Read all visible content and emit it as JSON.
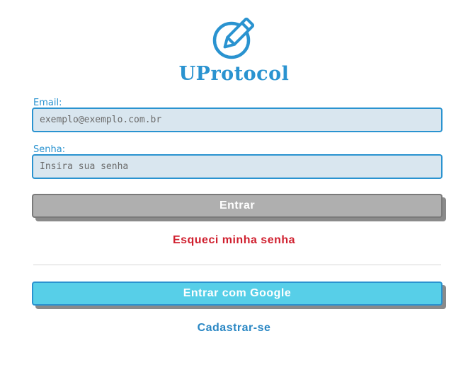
{
  "brand": {
    "name": "UProtocol",
    "logo_icon": "pencil-in-circle-icon",
    "color": "#2a93d0"
  },
  "form": {
    "email_label": "Email:",
    "email_placeholder": "exemplo@exemplo.com.br",
    "email_value": "",
    "password_label": "Senha:",
    "password_placeholder": "Insira sua senha",
    "password_value": ""
  },
  "actions": {
    "enter_label": "Entrar",
    "forgot_label": "Esqueci minha senha",
    "google_label": "Entrar com Google",
    "signup_label": "Cadastrar-se"
  },
  "colors": {
    "input_bg": "#d9e6ef",
    "enter_button": "#afafaf",
    "google_button": "#57cfe8",
    "forgot_link": "#d0202f",
    "signup_link": "#2a87c4"
  }
}
